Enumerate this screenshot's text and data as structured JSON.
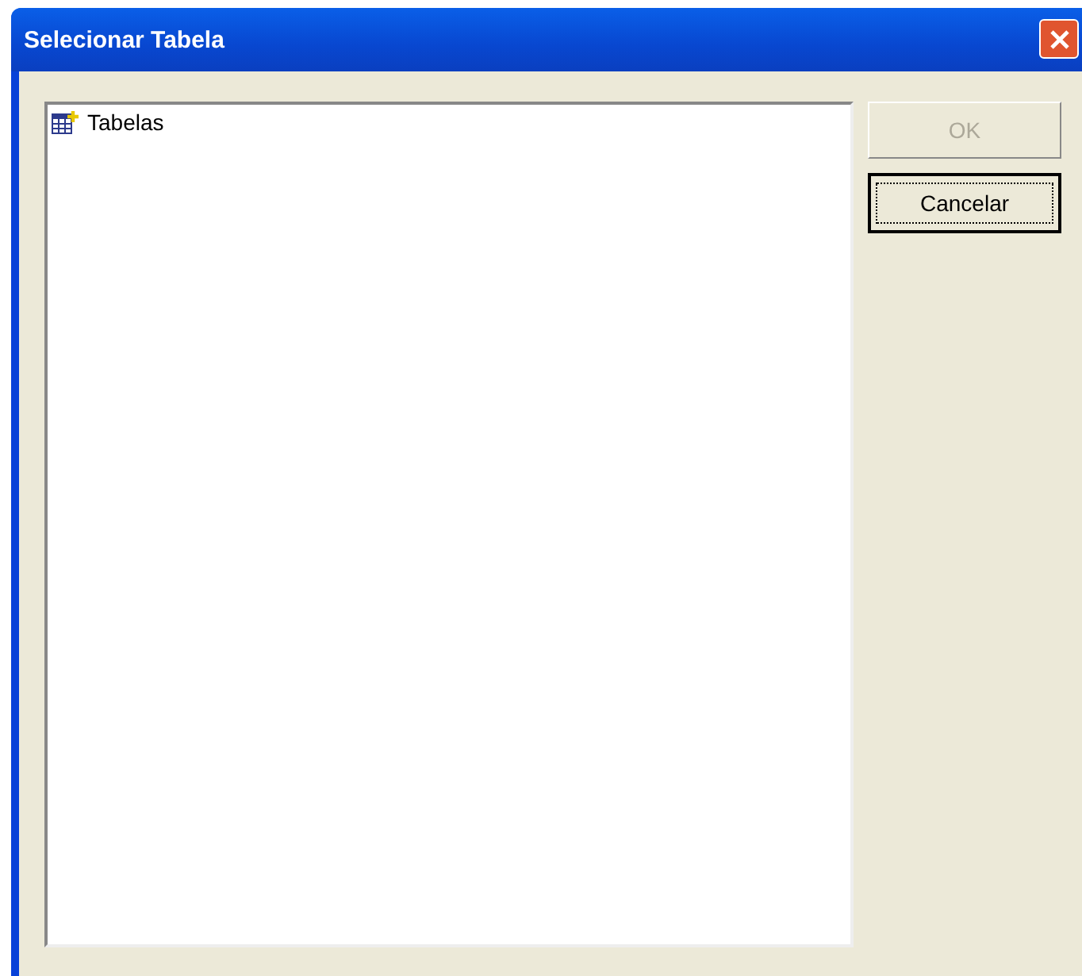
{
  "window": {
    "title": "Selecionar Tabela"
  },
  "tree": {
    "items": [
      {
        "label": "Tabelas",
        "selected": false
      }
    ]
  },
  "buttons": [
    {
      "label": "OK",
      "disabled": true,
      "focused": false
    },
    {
      "label": "Cancelar",
      "disabled": false,
      "focused": true
    }
  ]
}
